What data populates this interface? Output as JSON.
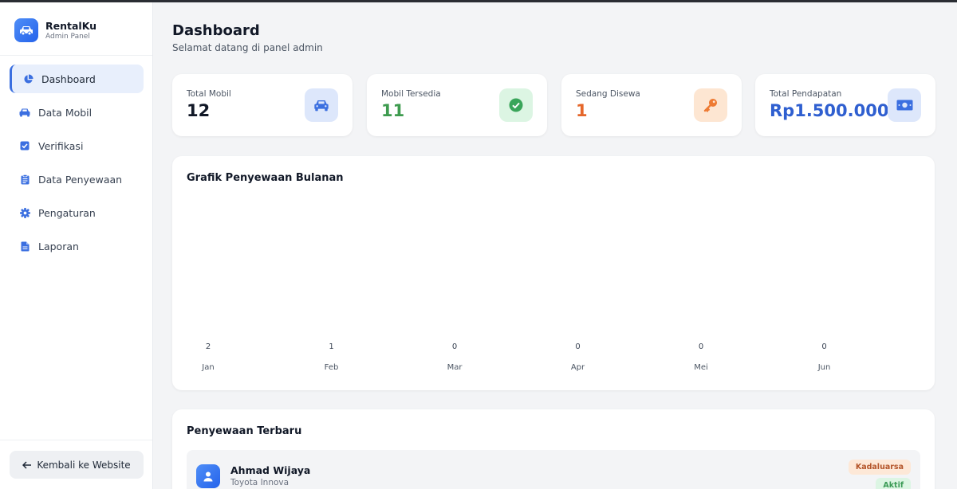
{
  "brand": {
    "name": "RentalKu",
    "subtitle": "Admin Panel"
  },
  "nav": [
    {
      "label": "Dashboard",
      "icon": "pie-chart-icon",
      "active": true
    },
    {
      "label": "Data Mobil",
      "icon": "car-icon"
    },
    {
      "label": "Verifikasi",
      "icon": "check-square-icon"
    },
    {
      "label": "Data Penyewaan",
      "icon": "clipboard-icon"
    },
    {
      "label": "Pengaturan",
      "icon": "gear-icon"
    },
    {
      "label": "Laporan",
      "icon": "file-icon"
    }
  ],
  "back_button": "Kembali ke Website",
  "header": {
    "title": "Dashboard",
    "subtitle": "Selamat datang di panel admin"
  },
  "stats": [
    {
      "label": "Total Mobil",
      "value": "12",
      "color": "#111827",
      "icon": "car-icon",
      "icon_bg": "#dde7fb",
      "icon_color": "#3b6fe0"
    },
    {
      "label": "Mobil Tersedia",
      "value": "11",
      "color": "#3e9b4f",
      "icon": "check-circle-icon",
      "icon_bg": "#dcf5e3",
      "icon_color": "#3aa55a"
    },
    {
      "label": "Sedang Disewa",
      "value": "1",
      "color": "#e5672b",
      "icon": "key-icon",
      "icon_bg": "#fde6d2",
      "icon_color": "#ee7a32"
    },
    {
      "label": "Total Pendapatan",
      "value": "Rp1.500.000",
      "color": "#2f5fd0",
      "icon": "money-icon",
      "icon_bg": "#dde7fb",
      "icon_color": "#3b6fe0"
    }
  ],
  "chart": {
    "title": "Grafik Penyewaan Bulanan"
  },
  "chart_data": {
    "type": "bar",
    "title": "Grafik Penyewaan Bulanan",
    "categories": [
      "Jan",
      "Feb",
      "Mar",
      "Apr",
      "Mei",
      "Jun"
    ],
    "values": [
      2,
      1,
      0,
      0,
      0,
      0
    ]
  },
  "recent": {
    "title": "Penyewaan Terbaru",
    "items": [
      {
        "name": "Ahmad Wijaya",
        "car": "Toyota Innova",
        "badges": [
          "Kadaluarsa",
          "Aktif"
        ]
      }
    ]
  }
}
